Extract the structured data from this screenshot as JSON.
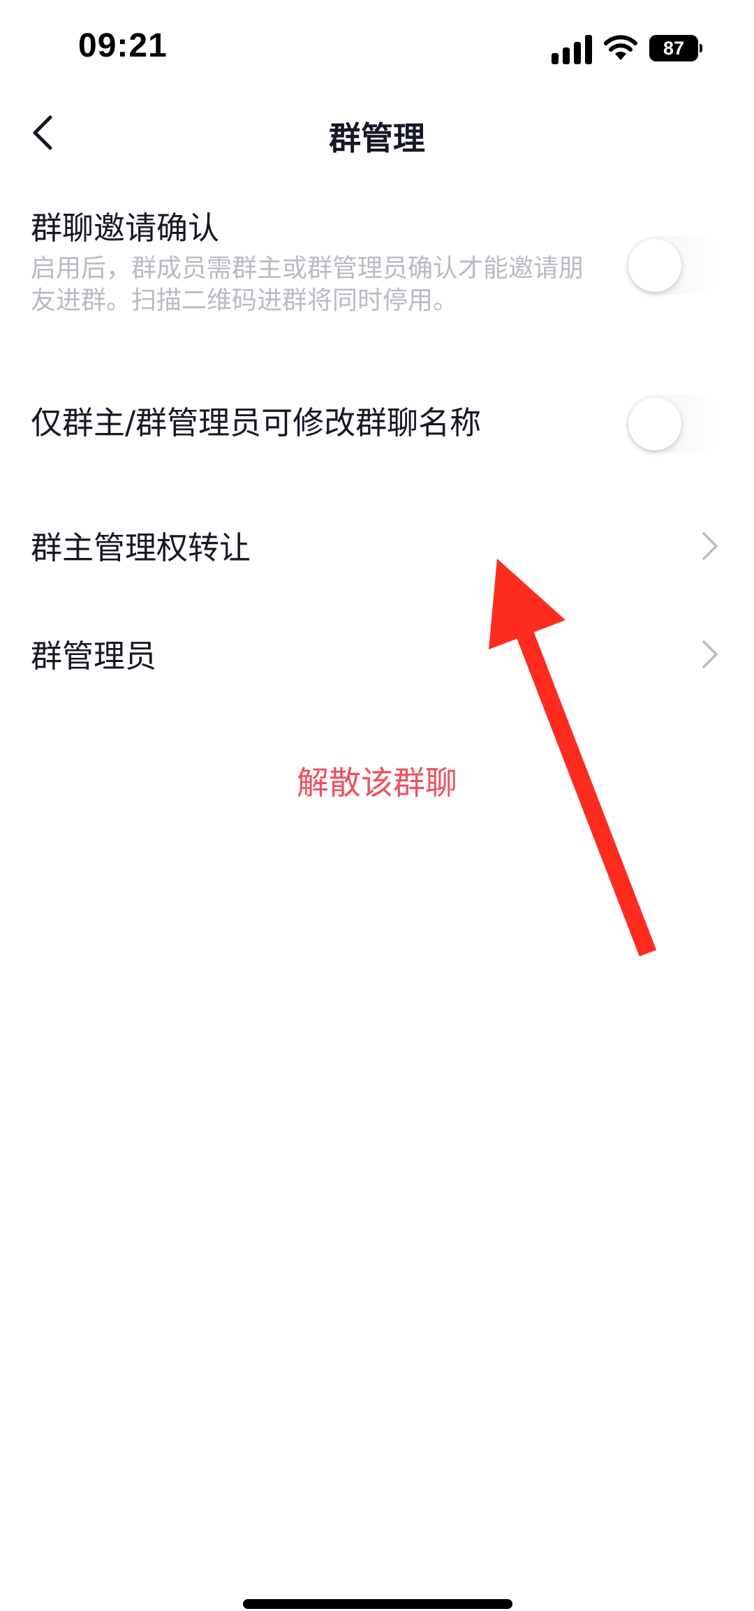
{
  "status_bar": {
    "time": "09:21",
    "battery": "87",
    "icons": [
      "signal-icon",
      "wifi-icon",
      "battery-icon"
    ]
  },
  "nav": {
    "title": "群管理",
    "back_icon": "chevron-left-icon"
  },
  "settings": {
    "invite_confirm": {
      "title": "群聊邀请确认",
      "description": "启用后，群成员需群主或群管理员确认才能邀请朋友进群。扫描二维码进群将同时停用。",
      "enabled": false
    },
    "rename_permission": {
      "title": "仅群主/群管理员可修改群聊名称",
      "enabled": false
    },
    "transfer_owner": {
      "title": "群主管理权转让",
      "icon": "chevron-right-icon"
    },
    "admins": {
      "title": "群管理员",
      "icon": "chevron-right-icon"
    }
  },
  "dissolve_label": "解散该群聊",
  "colors": {
    "text_primary": "#161823",
    "text_secondary": "#b8bbc2",
    "danger": "#f0505f",
    "annotation_arrow": "#fe2c1f"
  },
  "annotation": {
    "type": "arrow",
    "color": "#fe2c1f",
    "target": "transfer_owner"
  }
}
